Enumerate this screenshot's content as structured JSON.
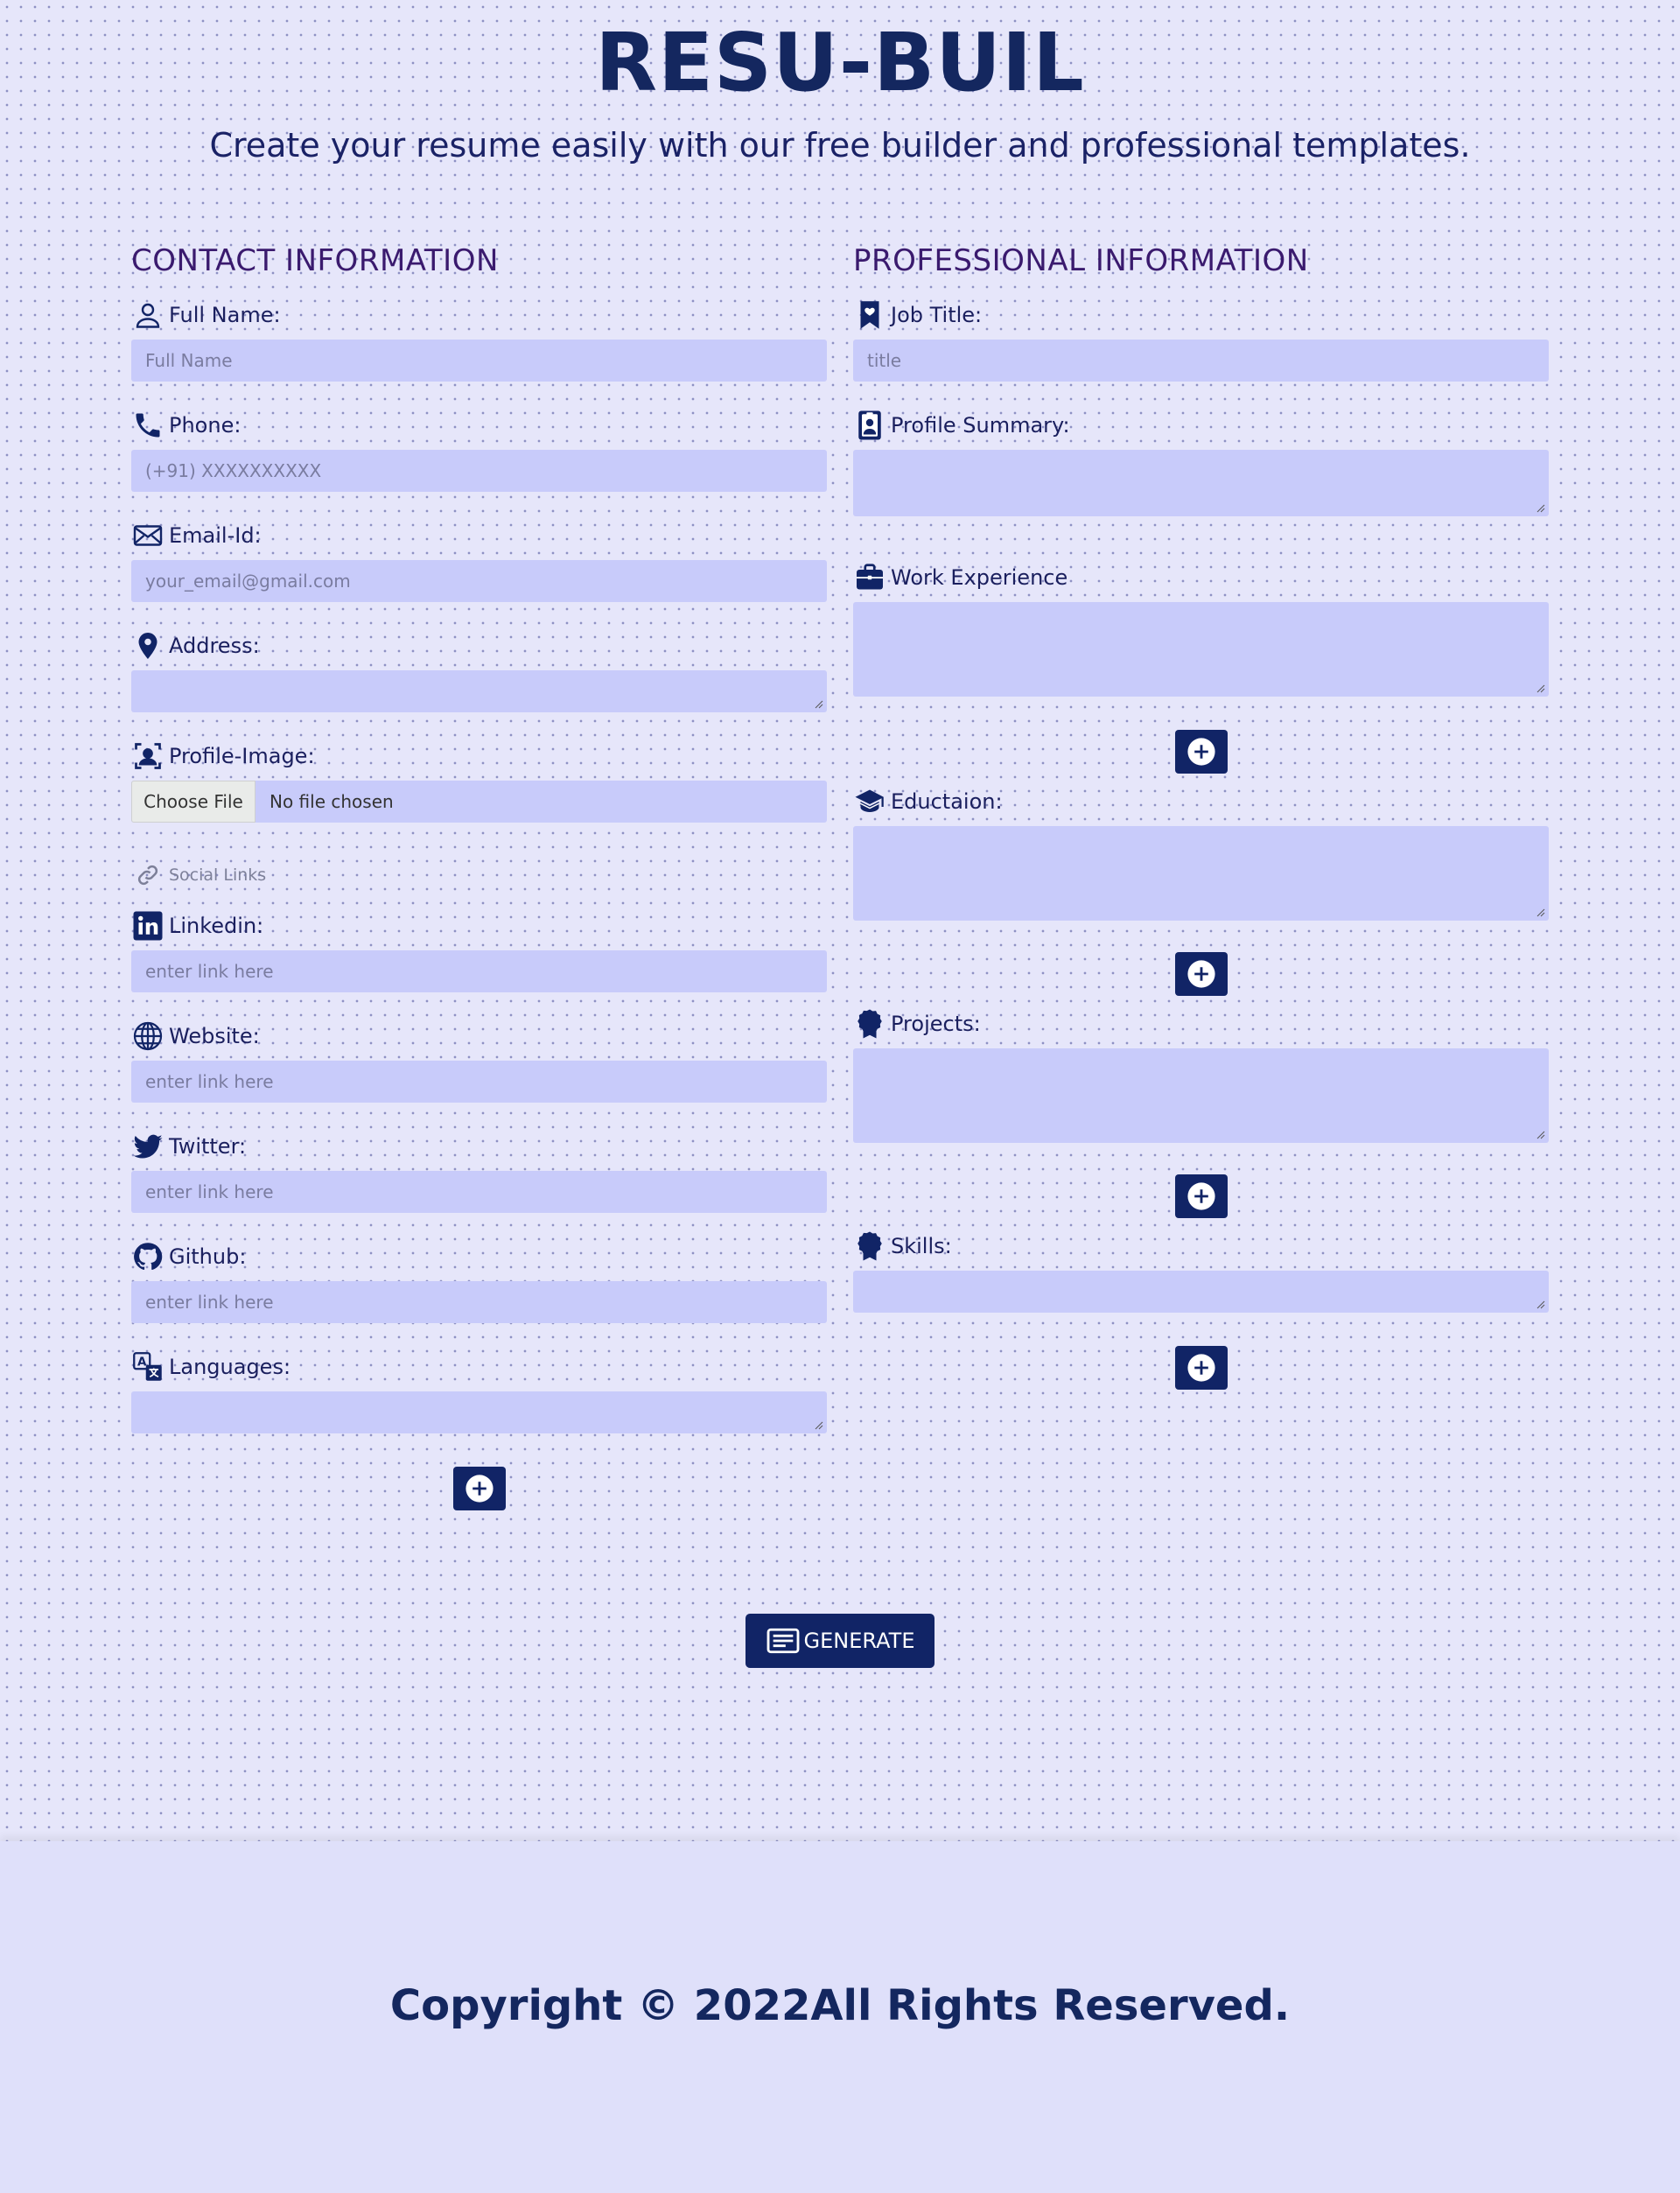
{
  "header": {
    "title": "RESU-BUIL",
    "subtitle": "Create your resume easily with our free builder and professional templates."
  },
  "contact": {
    "section_title": "CONTACT INFORMATION",
    "full_name_label": "Full Name:",
    "full_name_placeholder": "Full Name",
    "phone_label": "Phone:",
    "phone_placeholder": "(+91) XXXXXXXXXX",
    "email_label": "Email-Id:",
    "email_placeholder": "your_email@gmail.com",
    "address_label": "Address:",
    "profile_image_label": "Profile-Image:",
    "choose_file_label": "Choose File",
    "no_file_text": "No file chosen",
    "social_links_label": "Social Links",
    "linkedin_label": "Linkedin:",
    "linkedin_placeholder": "enter link here",
    "website_label": "Website:",
    "website_placeholder": "enter link here",
    "twitter_label": "Twitter:",
    "twitter_placeholder": "enter link here",
    "github_label": "Github:",
    "github_placeholder": "enter link here",
    "languages_label": "Languages:"
  },
  "professional": {
    "section_title": "PROFESSIONAL INFORMATION",
    "job_title_label": "Job Title:",
    "job_title_placeholder": "title",
    "profile_summary_label": "Profile Summary:",
    "work_experience_label": "Work Experience",
    "education_label": "Eductaion:",
    "projects_label": "Projects:",
    "skills_label": "Skills:"
  },
  "actions": {
    "generate_label": "GENERATE"
  },
  "footer": {
    "copyright": "Copyright © 2022All Rights Reserved."
  },
  "colors": {
    "background": "#e6e6fa",
    "field": "#c8cbfa",
    "accent": "#112466",
    "heading": "#3a1a6e"
  },
  "icons": [
    "user-icon",
    "phone-icon",
    "envelope-icon",
    "location-pin-icon",
    "profile-image-icon",
    "link-icon",
    "linkedin-icon",
    "globe-icon",
    "twitter-icon",
    "github-icon",
    "translate-icon",
    "bookmark-heart-icon",
    "person-badge-icon",
    "briefcase-icon",
    "graduation-cap-icon",
    "award-icon",
    "plus-circle-icon",
    "document-text-icon"
  ]
}
